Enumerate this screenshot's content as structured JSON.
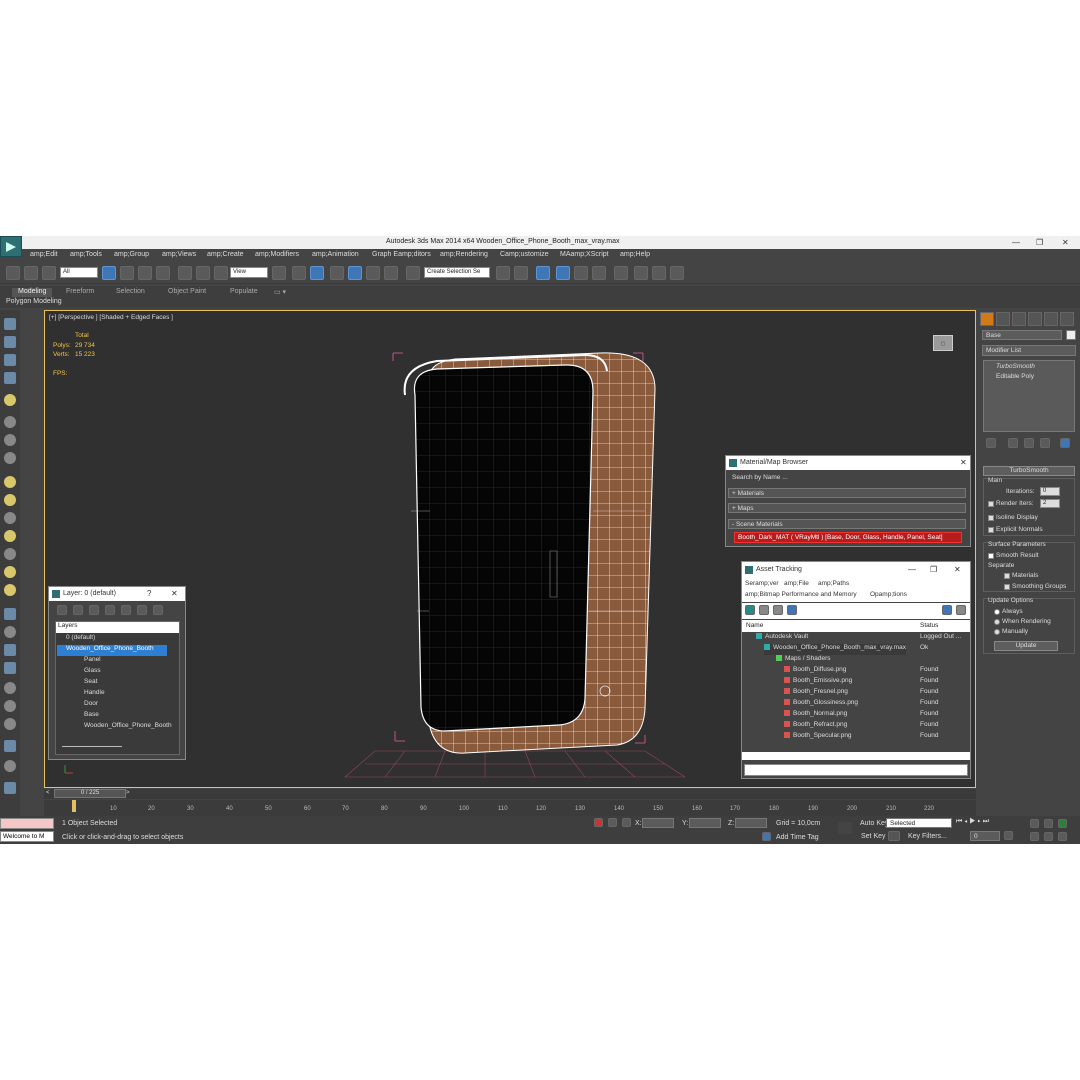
{
  "title": "Autodesk 3ds Max  2014 x64    Wooden_Office_Phone_Booth_max_vray.max",
  "menu": [
    "amp;Edit",
    "amp;Tools",
    "amp;Group",
    "amp;Views",
    "amp;Create",
    "amp;Modifiers",
    "amp;Animation",
    "Graph Eamp;ditors",
    "amp;Rendering",
    "Camp;ustomize",
    "MAamp;XScript",
    "amp;Help"
  ],
  "toolbar": {
    "filter": "All",
    "view": "View",
    "selection_set": "Create Selection Se"
  },
  "ribbon": {
    "tabs": [
      "Modeling",
      "Freeform",
      "Selection",
      "Object Paint",
      "Populate"
    ],
    "sub": "Polygon Modeling"
  },
  "viewport": {
    "label": "[+] [Perspective ] [Shaded + Edged Faces ]",
    "stats": {
      "total": "Total",
      "polys_label": "Polys:",
      "polys": "29 734",
      "verts_label": "Verts:",
      "verts": "15 223",
      "fps_label": "FPS:"
    }
  },
  "command_panel": {
    "object_name": "Base",
    "modifier_list": "Modifier List",
    "stack": [
      "TurboSmooth",
      "Editable Poly"
    ],
    "rollout_title": "TurboSmooth",
    "main": "Main",
    "iterations_label": "Iterations:",
    "iterations": "0",
    "render_iters_label": "Render Iters:",
    "render_iters": "2",
    "isoline": "Isoline Display",
    "explicit": "Explicit Normals",
    "surface_params": "Surface Parameters",
    "smooth_result": "Smooth Result",
    "separate": "Separate",
    "materials": "Materials",
    "smoothing_groups": "Smoothing Groups",
    "update_options": "Update Options",
    "always": "Always",
    "when_rendering": "When Rendering",
    "manually": "Manually",
    "update": "Update"
  },
  "layer_window": {
    "title": "Layer: 0 (default)",
    "help": "?",
    "header": "Layers",
    "rows": [
      "0 (default)",
      "Wooden_Office_Phone_Booth",
      "Panel",
      "Glass",
      "Seat",
      "Handle",
      "Door",
      "Base",
      "Wooden_Office_Phone_Booth"
    ]
  },
  "material_browser": {
    "title": "Material/Map Browser",
    "search": "Search by Name ...",
    "materials": "+ Materials",
    "maps": "+ Maps",
    "scene_materials": "- Scene Materials",
    "item": "Booth_Dark_MAT  ( VRayMtl )  [Base, Door, Glass, Handle, Panel, Seat]"
  },
  "asset_tracking": {
    "title": "Asset Tracking",
    "menu": [
      "Seramp;ver",
      "amp;File",
      "amp;Paths"
    ],
    "menu2": [
      "amp;Bitmap Performance and Memory",
      "Opamp;tions"
    ],
    "col_name": "Name",
    "col_status": "Status",
    "rows": [
      {
        "name": "Autodesk Vault",
        "status": "Logged Out ..."
      },
      {
        "name": "Wooden_Office_Phone_Booth_max_vray.max",
        "status": "Ok"
      },
      {
        "name": "Maps / Shaders",
        "status": ""
      },
      {
        "name": "Booth_Diffuse.png",
        "status": "Found"
      },
      {
        "name": "Booth_Emissive.png",
        "status": "Found"
      },
      {
        "name": "Booth_Fresnel.png",
        "status": "Found"
      },
      {
        "name": "Booth_Glossiness.png",
        "status": "Found"
      },
      {
        "name": "Booth_Normal.png",
        "status": "Found"
      },
      {
        "name": "Booth_Refract.png",
        "status": "Found"
      },
      {
        "name": "Booth_Specular.png",
        "status": "Found"
      }
    ]
  },
  "timeline": {
    "frame": "0 / 225",
    "ticks": [
      "10",
      "20",
      "30",
      "40",
      "50",
      "60",
      "70",
      "80",
      "90",
      "100",
      "110",
      "120",
      "130",
      "140",
      "150",
      "160",
      "170",
      "180",
      "190",
      "200",
      "210",
      "220"
    ]
  },
  "status": {
    "welcome": "Welcome to M",
    "selected": "1 Object Selected",
    "prompt": "Click or click-and-drag to select objects",
    "x": "X:",
    "y": "Y:",
    "z": "Z:",
    "grid": "Grid = 10,0cm",
    "add_time_tag": "Add Time Tag",
    "auto_key": "Auto Key",
    "selected_dropdown": "Selected",
    "set_key": "Set Key",
    "key_filters": "Key Filters...",
    "frame_field": "0"
  }
}
